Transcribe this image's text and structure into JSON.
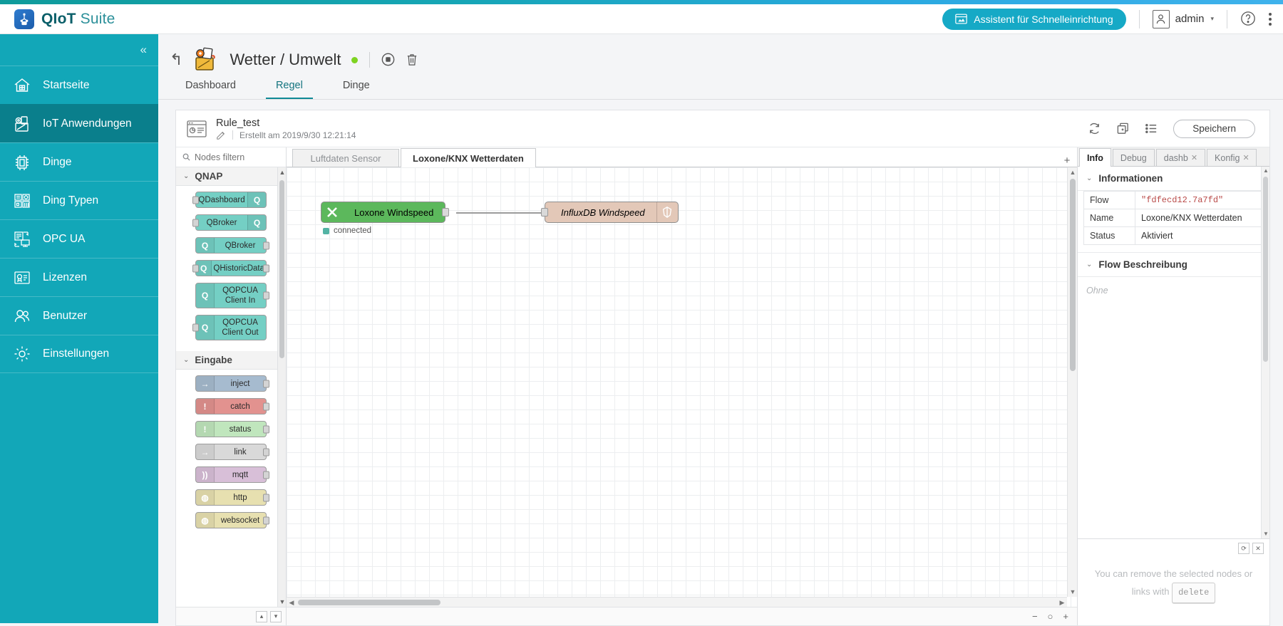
{
  "header": {
    "brand_bold": "QIoT",
    "brand_light": " Suite",
    "wizard_label": "Assistent für Schnelleinrichtung",
    "user_name": "admin"
  },
  "sidebar": {
    "collapse_label": "«",
    "items": [
      {
        "label": "Startseite",
        "icon": "home-icon",
        "active": false
      },
      {
        "label": "IoT Anwendungen",
        "icon": "apps-icon",
        "active": true
      },
      {
        "label": "Dinge",
        "icon": "chip-icon",
        "active": false
      },
      {
        "label": "Ding Typen",
        "icon": "grid-icon",
        "active": false
      },
      {
        "label": "OPC UA",
        "icon": "server-icon",
        "active": false
      },
      {
        "label": "Lizenzen",
        "icon": "license-icon",
        "active": false
      },
      {
        "label": "Benutzer",
        "icon": "users-icon",
        "active": false
      },
      {
        "label": "Einstellungen",
        "icon": "gear-icon",
        "active": false
      }
    ]
  },
  "page": {
    "title": "Wetter / Umwelt",
    "status_color": "#7ed321",
    "tabs": [
      {
        "label": "Dashboard",
        "active": false
      },
      {
        "label": "Regel",
        "active": true
      },
      {
        "label": "Dinge",
        "active": false
      }
    ]
  },
  "rule": {
    "name": "Rule_test",
    "created": "Erstellt am 2019/9/30 12:21:14",
    "save_label": "Speichern"
  },
  "palette": {
    "search_placeholder": "Nodes filtern",
    "groups": [
      {
        "name": "QNAP",
        "nodes": [
          {
            "label": "QDashboard",
            "color": "#74cfc4",
            "badge": "right",
            "in": true,
            "out": false,
            "glyph": "Q"
          },
          {
            "label": "QBroker",
            "color": "#74cfc4",
            "badge": "right",
            "in": true,
            "out": false,
            "glyph": "Q"
          },
          {
            "label": "QBroker",
            "color": "#74cfc4",
            "badge": "left",
            "in": false,
            "out": true,
            "glyph": "Q"
          },
          {
            "label": "QHistoricData",
            "color": "#74cfc4",
            "badge": "left",
            "in": true,
            "out": true,
            "glyph": "Q"
          },
          {
            "label": "QOPCUA Client In",
            "color": "#74cfc4",
            "badge": "left",
            "in": false,
            "out": true,
            "glyph": "Q"
          },
          {
            "label": "QOPCUA Client Out",
            "color": "#74cfc4",
            "badge": "left",
            "in": true,
            "out": false,
            "glyph": "Q"
          }
        ]
      },
      {
        "name": "Eingabe",
        "nodes": [
          {
            "label": "inject",
            "color": "#a6bbcf",
            "badge": "left",
            "in": false,
            "out": true,
            "glyph": "→"
          },
          {
            "label": "catch",
            "color": "#e2928f",
            "badge": "left",
            "in": false,
            "out": true,
            "glyph": "!"
          },
          {
            "label": "status",
            "color": "#c0e6bd",
            "badge": "left",
            "in": false,
            "out": true,
            "glyph": "!"
          },
          {
            "label": "link",
            "color": "#d9d9d9",
            "badge": "left",
            "in": false,
            "out": true,
            "glyph": "→"
          },
          {
            "label": "mqtt",
            "color": "#d8bfd8",
            "badge": "left",
            "in": false,
            "out": true,
            "glyph": "))"
          },
          {
            "label": "http",
            "color": "#e7e0b0",
            "badge": "left",
            "in": false,
            "out": true,
            "glyph": "◍"
          },
          {
            "label": "websocket",
            "color": "#e7e0b0",
            "badge": "left",
            "in": false,
            "out": true,
            "glyph": "◍"
          }
        ]
      }
    ]
  },
  "flow": {
    "tabs": [
      {
        "label": "Luftdaten Sensor",
        "active": false
      },
      {
        "label": "Loxone/KNX Wetterdaten",
        "active": true
      }
    ],
    "add_label": "+",
    "nodes": [
      {
        "label": "Loxone Windspeed",
        "color": "#5cb85c",
        "glyph": "X",
        "status": "connected",
        "status_color": "#53b3a4"
      },
      {
        "label": "InfluxDB Windspeed",
        "color": "#e3c8b8",
        "glyph": "◯",
        "italic": true
      }
    ],
    "zoom_out": "−",
    "zoom_reset": "○",
    "zoom_in": "+"
  },
  "info": {
    "tabs": [
      {
        "label": "Info",
        "active": true,
        "closable": false
      },
      {
        "label": "Debug",
        "active": false,
        "closable": false
      },
      {
        "label": "dashb",
        "active": false,
        "closable": true
      },
      {
        "label": "Konfig",
        "active": false,
        "closable": true
      }
    ],
    "section_information": "Informationen",
    "rows": [
      {
        "key": "Flow",
        "value": "\"fdfecd12.7a7fd\"",
        "mono": true
      },
      {
        "key": "Name",
        "value": "Loxone/KNX Wetterdaten",
        "mono": false
      },
      {
        "key": "Status",
        "value": "Aktiviert",
        "mono": false
      }
    ],
    "section_description": "Flow Beschreibung",
    "description_placeholder": "Ohne",
    "hint_line1": "You can remove the selected nodes or",
    "hint_line2_pre": "links with",
    "hint_key": "delete"
  }
}
